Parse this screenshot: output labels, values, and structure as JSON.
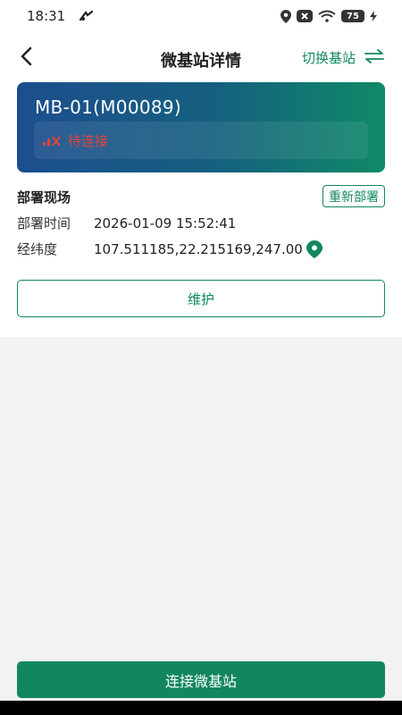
{
  "status_bar": {
    "time": "18:31",
    "battery": "75",
    "icons": [
      "signal-icon",
      "location-icon",
      "notification-icon",
      "wifi-icon",
      "battery-icon",
      "charging-icon"
    ]
  },
  "header": {
    "back_icon": "chevron-left-icon",
    "title": "微基站详情",
    "switch_label": "切换基站",
    "switch_icon": "swap-arrows-icon"
  },
  "station": {
    "name": "MB-01(M00089)",
    "status": "待连接",
    "status_icon": "no-signal-icon",
    "status_color": "#e2443b"
  },
  "deployment": {
    "section_title": "部署现场",
    "redeploy_label": "重新部署",
    "time_label": "部署时间",
    "time_value": "2026-01-09 15:52:41",
    "coord_label": "经纬度",
    "coord_value": "107.511185,22.215169,247.00"
  },
  "actions": {
    "maintain_label": "维护",
    "connect_label": "连接微基站"
  },
  "colors": {
    "accent": "#12875f",
    "card_gradient_start": "#1c4e8e",
    "card_gradient_end": "#0f8a66",
    "error": "#e2443b",
    "background": "#f2f2f2"
  }
}
